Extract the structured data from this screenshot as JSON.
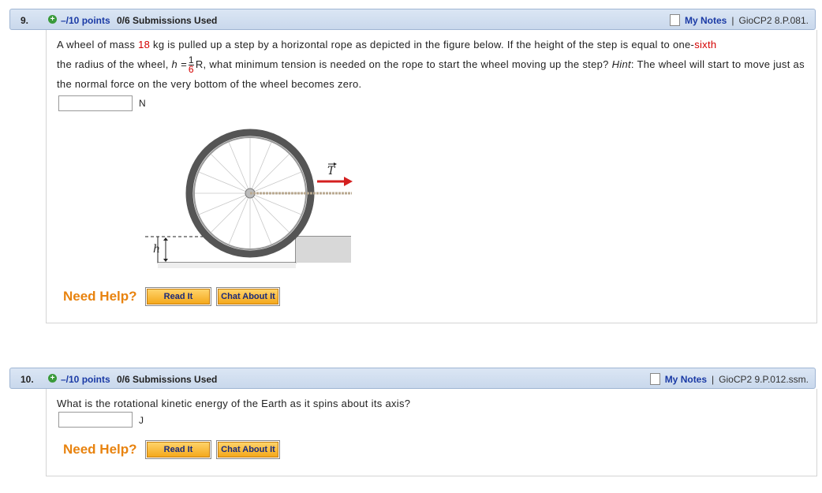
{
  "questions": [
    {
      "number": "9.",
      "points": "–/10 points",
      "submissions": "0/6 Submissions Used",
      "my_notes": "My Notes",
      "separator": "|",
      "ref": "GioCP2 8.P.081.",
      "text": {
        "p1": "A wheel of mass ",
        "mass": "18",
        "p2": " kg is pulled up a step by a horizontal rope as depicted in the figure below. If the height of the step is equal to one-",
        "fraction_word": "sixth",
        "p3": "the radius of the wheel, ",
        "h_eq": "h =",
        "frac_num": "1",
        "frac_den": "6",
        "p4": "R, what minimum tension is needed on the rope to start the wheel moving up the step? ",
        "hint_label": "Hint",
        "p5": ": The wheel will start to move just as the normal force on the very bottom of the wheel becomes zero."
      },
      "unit": "N",
      "figure": {
        "tension_label": "T",
        "height_label": "h"
      },
      "need_help": "Need Help?",
      "read_it": "Read It",
      "chat_about_it": "Chat About It"
    },
    {
      "number": "10.",
      "points": "–/10 points",
      "submissions": "0/6 Submissions Used",
      "my_notes": "My Notes",
      "separator": "|",
      "ref": "GioCP2 9.P.012.ssm.",
      "text": "What is the rotational kinetic energy of the Earth as it spins about its axis?",
      "unit": "J",
      "need_help": "Need Help?",
      "read_it": "Read It",
      "chat_about_it": "Chat About It"
    }
  ]
}
